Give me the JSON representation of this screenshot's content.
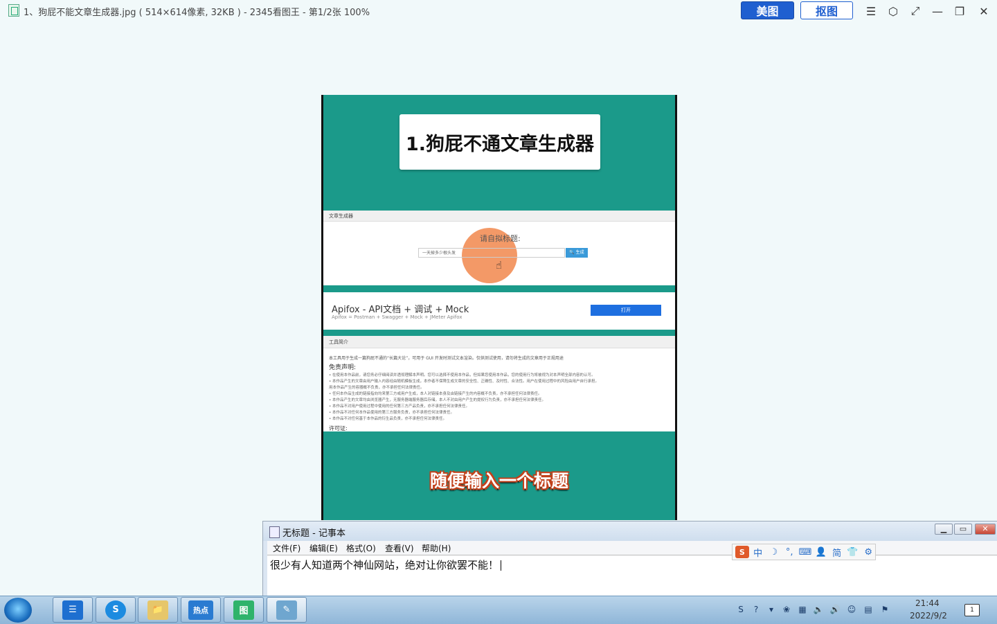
{
  "viewer": {
    "title": "1、狗屁不能文章生成器.jpg ( 514×614像素, 32KB ) - 2345看图王 - 第1/2张 100%",
    "btn_meitu": "美图",
    "btn_koutu": "抠图",
    "controls": [
      "☰",
      "⬡",
      "⤢",
      "—",
      "❐",
      "✕"
    ]
  },
  "image_content": {
    "card_title": "1.狗屁不通文章生成器",
    "panel1_header": "文章生成器",
    "prompt": "请自拟标题:",
    "input_value": "一天掉多少根头发",
    "generate_btn": "🔍 生成",
    "ad_title": "Apifox - API文档 + 调试 + Mock",
    "ad_subtitle": "Apifox = Postman + Swagger + Mock + JMeter Apifox",
    "ad_button": "打开",
    "intro_header": "工具简介",
    "intro_text": "本工具用于生成一篇狗屁不通的“长篇大论”，可用于 GUI 开发时测试文本渲染。仅供测试使用，请勿将生成的文章用于正规用途",
    "disclaimer_head": "免责声明:",
    "bullets": [
      "• 在使用本作品前，请您务必仔细阅读并透彻理解本声明。您可以选择不使用本作品，但如果您使用本作品，您的使用行为将被视为对本声明全部内容的认可。",
      "• 本作品产生的文章由用户输入内容经由随机模板生成，本作者不保障生成文章的安全性、正确性、及时性、合法性。用户在使用过程中的风险由用户自行承担。",
      "   用本作品产生的容器概不负责，亦不承担任何法律责任。",
      "• 任何本作品生成的链接指向均来第三方或用户生成，本人对链接本身及由链接产生的内容概不负责，亦不承担任何法律责任。",
      "• 本作品产生的文章均由浏览器产生，无服务器端服务器后存储，本人不对由用户产生的提权行为负责，亦不承担任何法律责任。",
      "• 本作品不对用户使用过程中使用的任何第三方产品负责，亦不承担任何法律责任。",
      "• 本作品不对任何本作品使用的第三方服务负责，亦不承担任何法律责任。",
      "• 本作品不对任何基于本作品的衍生品负责，亦不承担任何法律责任。"
    ],
    "license_head": "许可证:",
    "caption": "随便输入一个标题"
  },
  "notepad": {
    "title": "无标题 - 记事本",
    "menus": [
      "文件(F)",
      "编辑(E)",
      "格式(O)",
      "查看(V)",
      "帮助(H)"
    ],
    "text": "很少有人知道两个神仙网站，绝对让你欲罢不能！",
    "ctl_min": "▁",
    "ctl_max": "▭",
    "ctl_close": "✕"
  },
  "ime": {
    "logo": "S",
    "items": [
      "中",
      "☽",
      "°,",
      "⌨",
      "👤",
      "简",
      "👕",
      "⚙"
    ]
  },
  "taskbar": {
    "apps": [
      "☰",
      "S",
      "📁",
      "热点",
      "图",
      "✎"
    ],
    "tray": [
      "S",
      "?",
      "▾",
      "❀",
      "▦",
      "🔈",
      "🔊",
      "☺",
      "▤",
      "⚑"
    ],
    "time": "21:44",
    "date": "2022/9/2",
    "notif": "1"
  },
  "colors": {
    "accent": "#1f5fd0",
    "image_bg": "#1b9a8a",
    "caption_outline": "#c2411b"
  }
}
